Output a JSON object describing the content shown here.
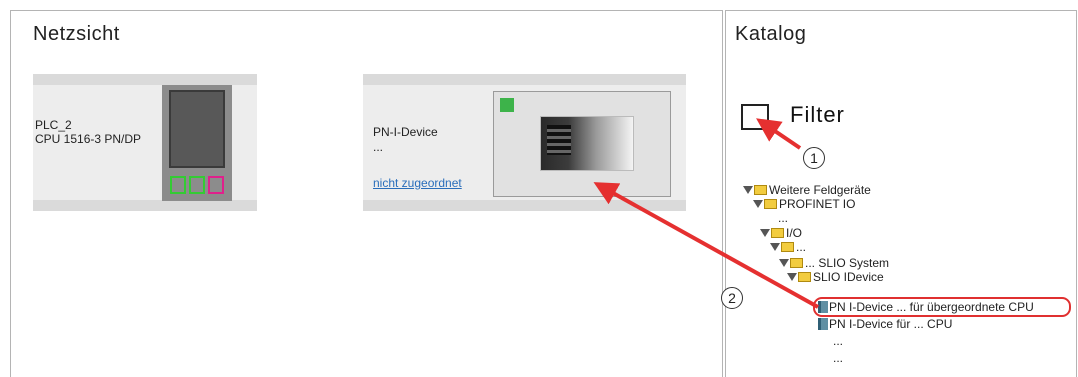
{
  "network_view": {
    "title": "Netzsicht",
    "plc": {
      "name": "PLC_2",
      "type": "CPU 1516-3 PN/DP"
    },
    "pn_device": {
      "name": "PN-I-Device",
      "sub": "...",
      "link": "nicht zugeordnet"
    }
  },
  "catalog": {
    "title": "Katalog",
    "filter_label": "Filter",
    "callouts": {
      "one": "1",
      "two": "2"
    },
    "tree": [
      {
        "label": "Weitere Feldgeräte"
      },
      {
        "label": "PROFINET IO"
      },
      {
        "label": "..."
      },
      {
        "label": "I/O"
      },
      {
        "label": "..."
      },
      {
        "label": "... SLIO System"
      },
      {
        "label": "SLIO IDevice"
      },
      {
        "label": "PN I-Device ... für übergeordnete CPU"
      },
      {
        "label": "PN I-Device für ... CPU"
      },
      {
        "label": "..."
      },
      {
        "label": "..."
      }
    ]
  },
  "colors": {
    "arrow": "#e53030",
    "led": "#3db34a",
    "slot_green": "#33cc33",
    "slot_magenta": "#e0208c",
    "folder": "#f2cc3f"
  }
}
